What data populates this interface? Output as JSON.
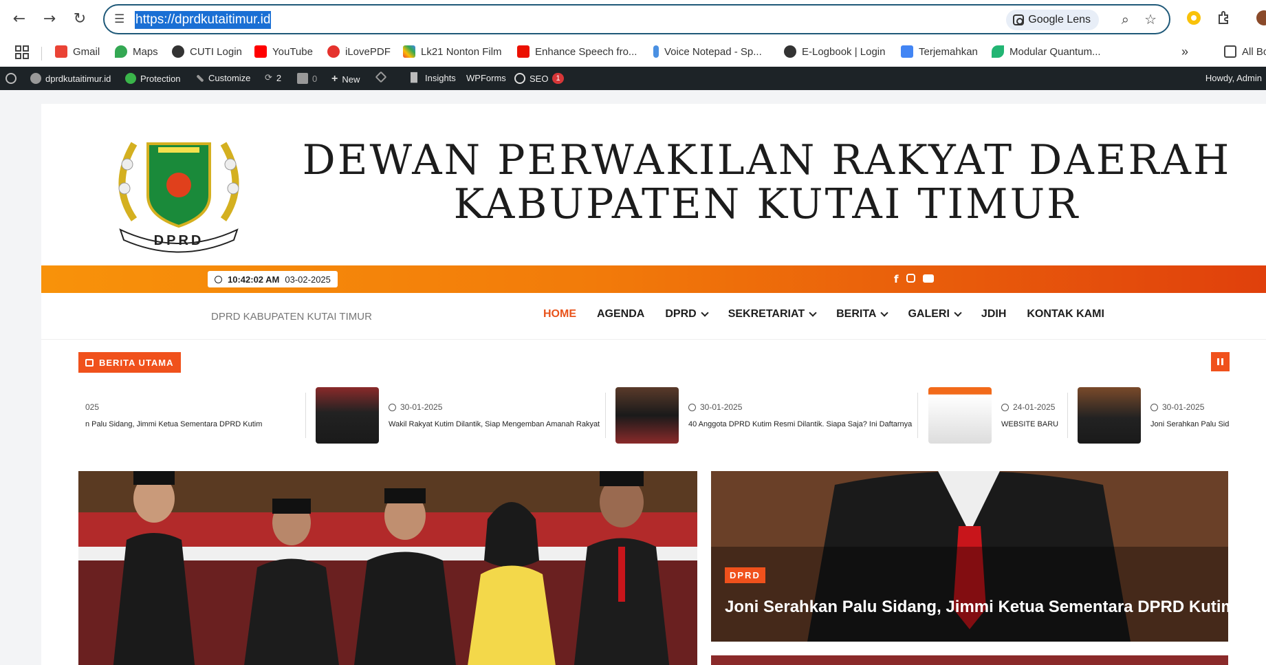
{
  "browser": {
    "url": "https://dprdkutaitimur.id",
    "lens_label": "Google Lens",
    "bookmarks": [
      {
        "label": "Gmail",
        "icon": "gmail-icon"
      },
      {
        "label": "Maps",
        "icon": "maps-icon"
      },
      {
        "label": "CUTI Login",
        "icon": "globe-icon"
      },
      {
        "label": "YouTube",
        "icon": "youtube-icon"
      },
      {
        "label": "iLovePDF",
        "icon": "heart-icon"
      },
      {
        "label": "Lk21 Nonton Film",
        "icon": "pinwheel-icon"
      },
      {
        "label": "Enhance Speech fro...",
        "icon": "adobe-icon"
      },
      {
        "label": "Voice Notepad - Sp...",
        "icon": "microphone-icon"
      },
      {
        "label": "E-Logbook | Login",
        "icon": "globe-icon"
      },
      {
        "label": "Terjemahkan",
        "icon": "translate-icon"
      },
      {
        "label": "Modular Quantum...",
        "icon": "leaf-icon"
      }
    ],
    "all_bookmarks_label": "All Bo",
    "more_label": "»"
  },
  "wp_admin_bar": {
    "site": "dprdkutaitimur.id",
    "protection": "Protection",
    "customize": "Customize",
    "updates": "2",
    "comments": "0",
    "new": "New",
    "insights": "Insights",
    "wpforms": "WPForms",
    "seo": "SEO",
    "seo_badge": "1",
    "howdy": "Howdy, Admin"
  },
  "site": {
    "title_line1": "DEWAN PERWAKILAN RAKYAT DAERAH",
    "title_line2": "KABUPATEN KUTAI TIMUR",
    "logo_text": "DPRD",
    "time": "10:42:02 AM",
    "date": "03-02-2025",
    "tagline": "DPRD KABUPATEN KUTAI TIMUR",
    "menu": [
      {
        "label": "HOME",
        "active": true,
        "dropdown": false
      },
      {
        "label": "AGENDA",
        "active": false,
        "dropdown": false
      },
      {
        "label": "DPRD",
        "active": false,
        "dropdown": true
      },
      {
        "label": "SEKRETARIAT",
        "active": false,
        "dropdown": true
      },
      {
        "label": "BERITA",
        "active": false,
        "dropdown": true
      },
      {
        "label": "GALERI",
        "active": false,
        "dropdown": true
      },
      {
        "label": "JDIH",
        "active": false,
        "dropdown": false
      },
      {
        "label": "KONTAK KAMI",
        "active": false,
        "dropdown": false
      }
    ],
    "ticker_label": "BERITA UTAMA",
    "ticker": [
      {
        "date": "025",
        "title": "n Palu Sidang, Jimmi Ketua Sementara DPRD Kutim"
      },
      {
        "date": "30-01-2025",
        "title": "Wakil Rakyat Kutim Dilantik, Siap Mengemban Amanah Rakyat"
      },
      {
        "date": "30-01-2025",
        "title": "40 Anggota DPRD Kutim Resmi Dilantik. Siapa Saja? Ini Daftarnya"
      },
      {
        "date": "24-01-2025",
        "title": "WEBSITE BARU"
      },
      {
        "date": "30-01-2025",
        "title": "Joni Serahkan Palu Sidang, Jimm"
      }
    ],
    "featured_category": "DPRD",
    "featured_title": "Joni Serahkan Palu Sidang, Jimmi Ketua Sementara DPRD Kutim"
  },
  "colors": {
    "accent": "#f0511c",
    "wp_bar": "#1d2327",
    "omnibox_border": "#1e5878"
  }
}
